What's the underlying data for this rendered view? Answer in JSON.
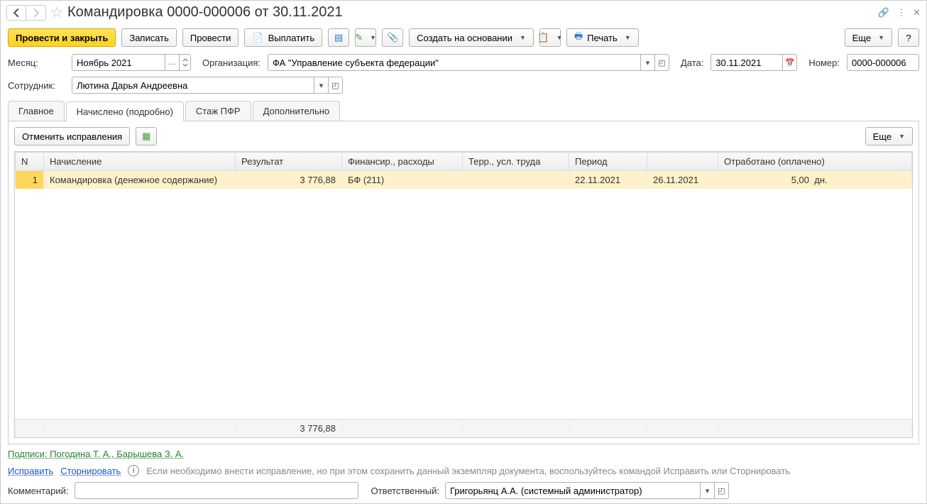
{
  "title": "Командировка 0000-000006 от 30.11.2021",
  "toolbar": {
    "post_close": "Провести и закрыть",
    "save": "Записать",
    "post": "Провести",
    "pay": "Выплатить",
    "create_basis": "Создать на основании",
    "print": "Печать",
    "more": "Еще",
    "help": "?"
  },
  "fields": {
    "month_lbl": "Месяц:",
    "month": "Ноябрь 2021",
    "org_lbl": "Организация:",
    "org": "ФА \"Управление субъекта федерации\"",
    "date_lbl": "Дата:",
    "date": "30.11.2021",
    "number_lbl": "Номер:",
    "number": "0000-000006",
    "emp_lbl": "Сотрудник:",
    "emp": "Лютина Дарья Андреевна"
  },
  "tabs": {
    "main": "Главное",
    "accrued": "Начислено (подробно)",
    "pfr": "Стаж ПФР",
    "extra": "Дополнительно"
  },
  "panel": {
    "cancel": "Отменить исправления",
    "more": "Еще"
  },
  "cols": {
    "n": "N",
    "accrual": "Начисление",
    "result": "Результат",
    "fin": "Финансир., расходы",
    "terr": "Терр., усл. труда",
    "period": "Период",
    "worked": "Отработано (оплачено)"
  },
  "row": {
    "n": "1",
    "accrual": "Командировка (денежное содержание)",
    "result": "3 776,88",
    "fin": "БФ (211)",
    "terr": "",
    "pstart": "22.11.2021",
    "pend": "26.11.2021",
    "worked": "5,00",
    "unit": "дн."
  },
  "footer_total": "3 776,88",
  "signatures": "Подписи: Погодина Т. А., Барышева З. А.",
  "fix": "Исправить",
  "storno": "Сторнировать",
  "hint": "Если необходимо внести исправление, но при этом сохранить данный экземпляр документа, воспользуйтесь командой Исправить или Сторнировать",
  "comment_lbl": "Комментарий:",
  "comment": "",
  "resp_lbl": "Ответственный:",
  "resp": "Григорьянц А.А. (системный администратор)"
}
